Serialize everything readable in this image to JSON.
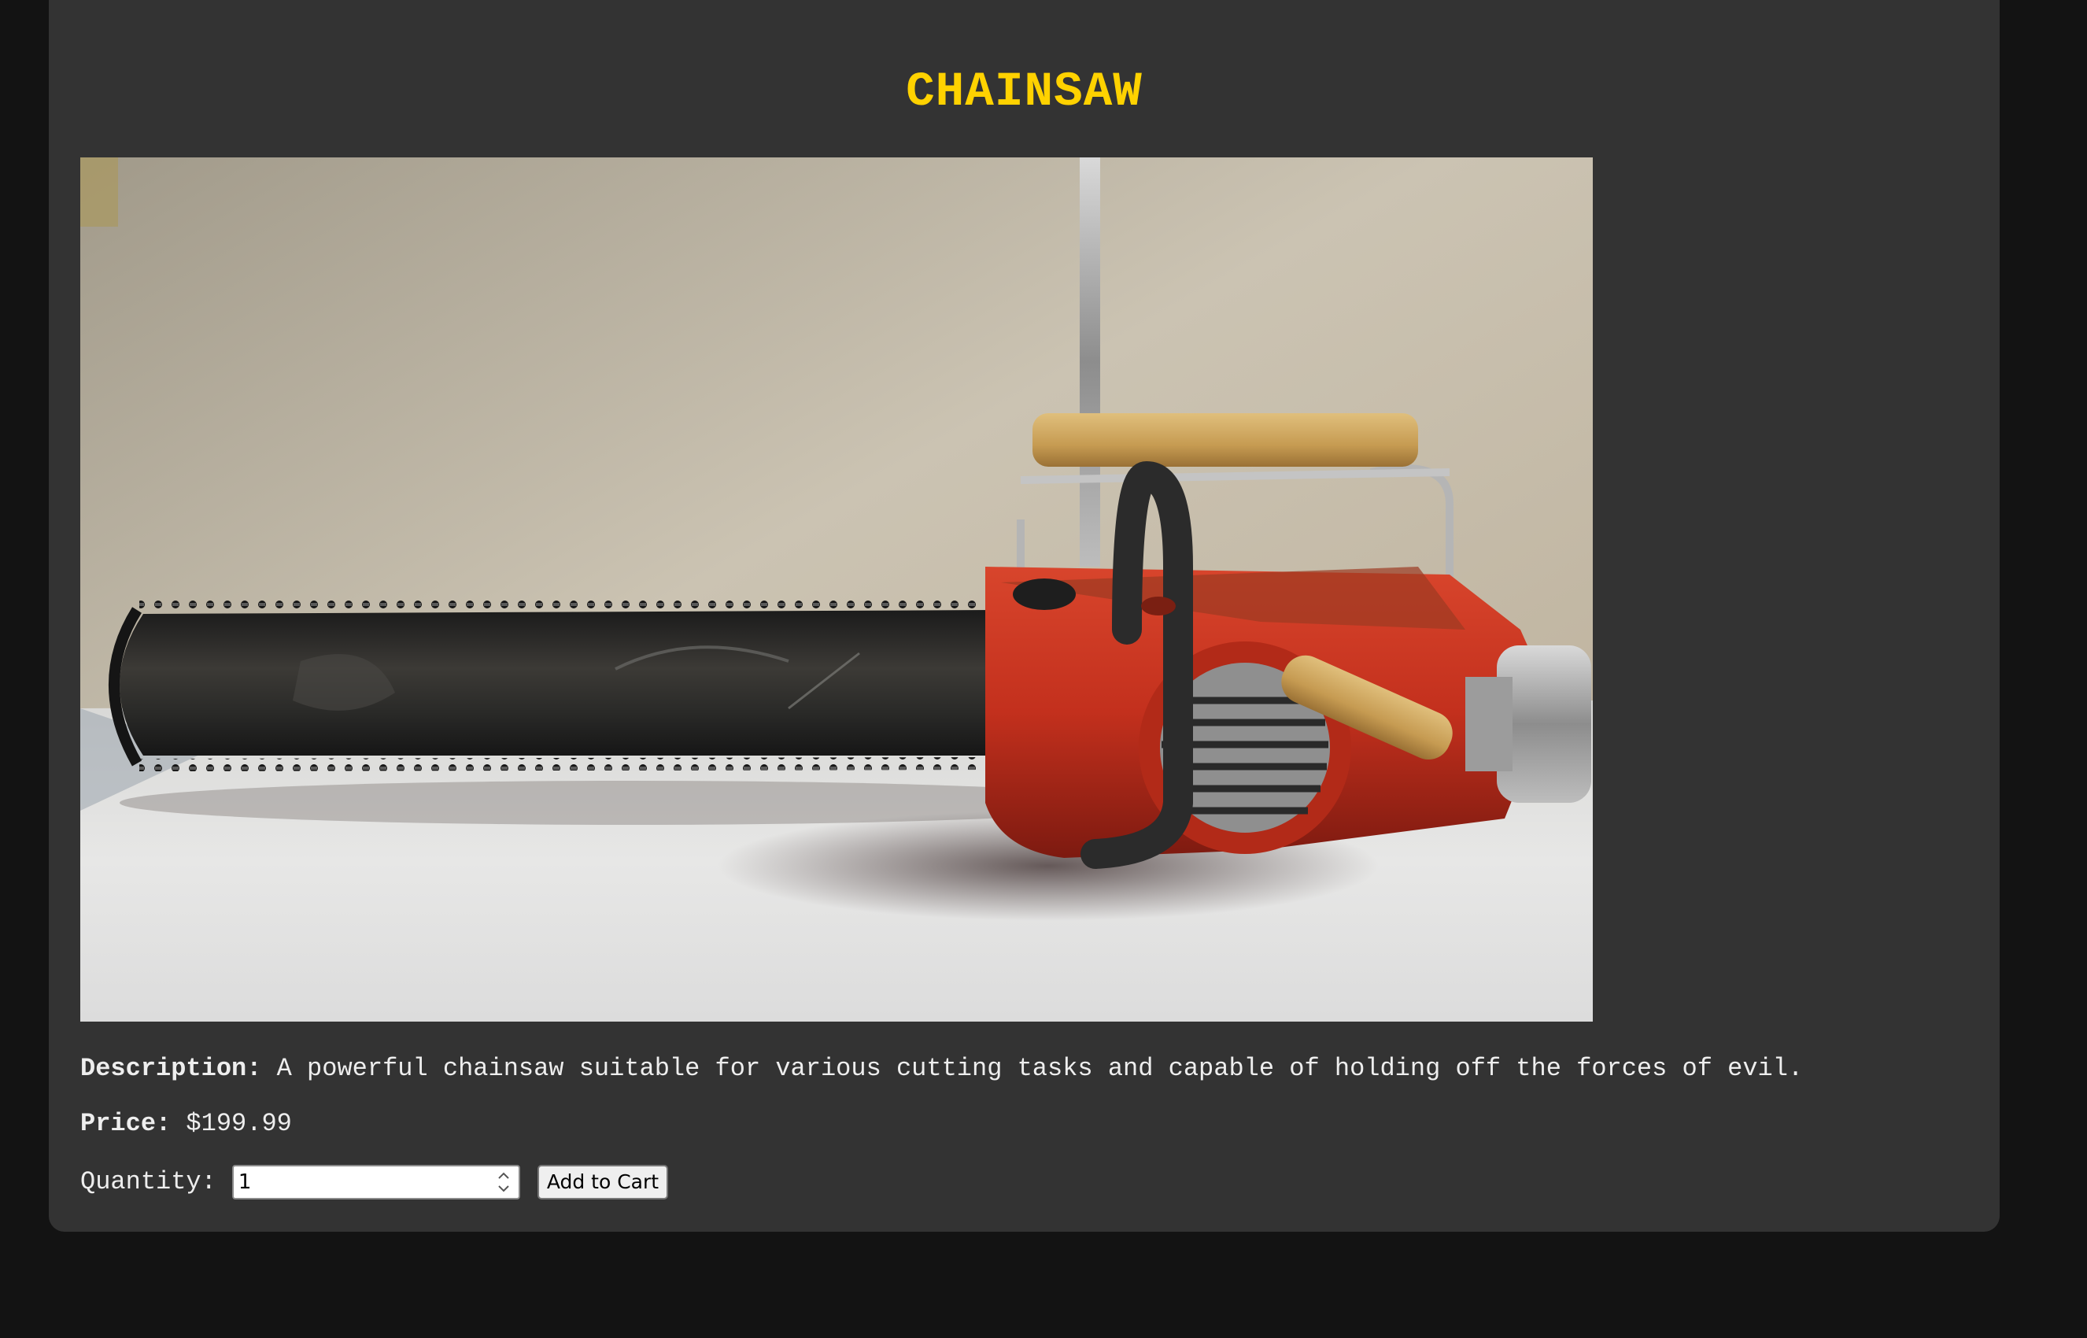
{
  "product": {
    "title": "CHAINSAW",
    "image": {
      "subject": "chainsaw-photo",
      "wall_color": "#cbc3b2",
      "table_color": "#e6e6e6",
      "body_color": "#c8311f",
      "bar_color": "#252525",
      "handle_wood_color": "#c9a25b"
    },
    "description_label": "Description:",
    "description_text": "A powerful chainsaw suitable for various cutting tasks and capable of holding off the forces of evil.",
    "price_label": "Price:",
    "price_value": "$199.99",
    "quantity_label": "Quantity:",
    "quantity_value": "1",
    "add_to_cart_label": "Add to Cart"
  },
  "colors": {
    "page_background": "#131313",
    "card_background": "#333333",
    "title_color": "#ffd200",
    "text_color": "#eeeeee"
  },
  "icons": {
    "spinner_up": "chevron-up-icon",
    "spinner_down": "chevron-down-icon"
  }
}
